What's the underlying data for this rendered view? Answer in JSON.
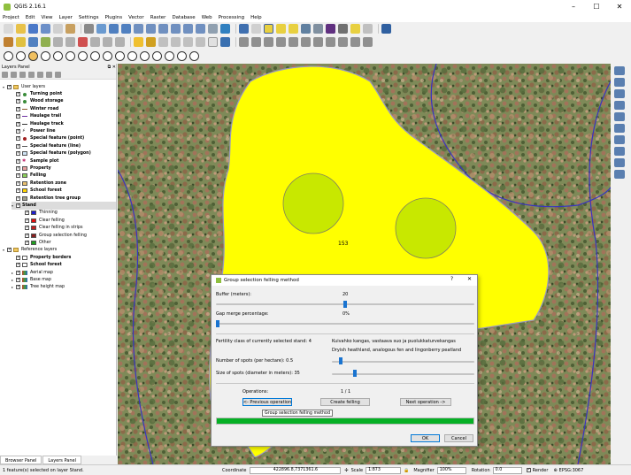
{
  "window": {
    "title": "QGIS 2.16.1",
    "min": "–",
    "max": "☐",
    "close": "✕"
  },
  "menu": [
    "Project",
    "Edit",
    "View",
    "Layer",
    "Settings",
    "Plugins",
    "Vector",
    "Raster",
    "Database",
    "Web",
    "Processing",
    "Help"
  ],
  "layers_panel": {
    "title": "Layers Panel",
    "items": [
      {
        "label": "User layers",
        "bold": false,
        "indent": 0,
        "exp": "▾",
        "sym": "group"
      },
      {
        "label": "Turning point",
        "bold": true,
        "indent": 1,
        "sym": "dot",
        "color": "#3a8c3a"
      },
      {
        "label": "Wood storage",
        "bold": true,
        "indent": 1,
        "sym": "dot",
        "color": "#3a8c3a"
      },
      {
        "label": "Winter road",
        "bold": true,
        "indent": 1,
        "sym": "line",
        "color": "#8a5a2b"
      },
      {
        "label": "Haulage trail",
        "bold": true,
        "indent": 1,
        "sym": "line",
        "color": "#6b2fa0"
      },
      {
        "label": "Haulage track",
        "bold": true,
        "indent": 1,
        "sym": "line",
        "color": "#333333"
      },
      {
        "label": "Power line",
        "bold": true,
        "indent": 1,
        "sym": "power",
        "color": "#000000"
      },
      {
        "label": "Special feature (point)",
        "bold": true,
        "indent": 1,
        "sym": "dot",
        "color": "#a02020"
      },
      {
        "label": "Special feature (line)",
        "bold": true,
        "indent": 1,
        "sym": "line",
        "color": "#555555"
      },
      {
        "label": "Special feature (polygon)",
        "bold": true,
        "indent": 1,
        "sym": "box",
        "color": "#cfe3f3"
      },
      {
        "label": "Sample plot",
        "bold": true,
        "indent": 1,
        "sym": "star",
        "color": "#c03070"
      },
      {
        "label": "Property",
        "bold": true,
        "indent": 1,
        "sym": "box",
        "color": "#e8a0a0"
      },
      {
        "label": "Felling",
        "bold": true,
        "indent": 1,
        "sym": "box",
        "color": "#8bd05a"
      },
      {
        "label": "Retention zone",
        "bold": true,
        "indent": 1,
        "sym": "box",
        "color": "#e8c070"
      },
      {
        "label": "School forest",
        "bold": true,
        "indent": 1,
        "sym": "box",
        "color": "#ffd400"
      },
      {
        "label": "Retention tree group",
        "bold": true,
        "indent": 1,
        "sym": "box",
        "color": "#a0a090"
      },
      {
        "label": "Stand",
        "bold": true,
        "indent": 1,
        "exp": "▾",
        "sym": "none",
        "sel": true
      },
      {
        "label": "Thinning",
        "bold": false,
        "indent": 2,
        "sym": "box",
        "color": "#1f1fd0"
      },
      {
        "label": "Clear felling",
        "bold": false,
        "indent": 2,
        "sym": "box",
        "color": "#e01010"
      },
      {
        "label": "Clear felling in strips",
        "bold": false,
        "indent": 2,
        "sym": "box",
        "color": "#c02020"
      },
      {
        "label": "Group selection felling",
        "bold": false,
        "indent": 2,
        "sym": "box",
        "color": "#8a2020"
      },
      {
        "label": "Other",
        "bold": false,
        "indent": 2,
        "sym": "box",
        "color": "#20a020"
      },
      {
        "label": "Reference layers",
        "bold": false,
        "indent": 0,
        "exp": "▾",
        "sym": "group"
      },
      {
        "label": "Property borders",
        "bold": true,
        "indent": 1,
        "sym": "box",
        "color": "#ffffff"
      },
      {
        "label": "School forest",
        "bold": true,
        "indent": 1,
        "sym": "box",
        "color": "#ffffff"
      },
      {
        "label": "Aerial map",
        "bold": false,
        "indent": 1,
        "exp": "▸",
        "sym": "raster"
      },
      {
        "label": "Base map",
        "bold": false,
        "indent": 1,
        "exp": "▸",
        "sym": "raster"
      },
      {
        "label": "Tree height map",
        "bold": false,
        "indent": 1,
        "exp": "▸",
        "sym": "raster"
      }
    ]
  },
  "bottom_tabs": [
    "Browser Panel",
    "Layers Panel"
  ],
  "map": {
    "stand_label": "153",
    "polygon_color": "#ffff00",
    "circle_color": "#c8e800"
  },
  "dialog": {
    "title": "Group selection felling method",
    "help": "?",
    "close": "✕",
    "buffer_label": "Buffer (meters):",
    "buffer_value": "20",
    "buffer_fraction": 0.5,
    "gap_label": "Gap merge percentage:",
    "gap_value": "0%",
    "gap_fraction": 0.0,
    "fertility_label": "Fertility class of currently selected stand: 4",
    "fertility_fi": "Kuivahko kangas, vastaava suo ja puolukkaturvekangas",
    "fertility_en": "Dryish heathland, analogous fen and lingonberry peatland",
    "spots_label": "Number of spots (per hectare): 0.5",
    "spots_fraction": 0.05,
    "size_label": "Size of spots (diameter in meters): 35",
    "size_fraction": 0.15,
    "operations_label": "Operations:",
    "operations_value": "1 / 1",
    "prev_label": "<- Previous operation",
    "create_label": "Create felling",
    "next_label": "Next operation ->",
    "progress": 1.0,
    "ok_label": "OK",
    "cancel_label": "Cancel"
  },
  "tooltip": "Group selection felling method",
  "status": {
    "message": "1 feature(s) selected on layer Stand.",
    "coordinate_label": "Coordinate",
    "coordinate_value": "422896.8,7371361.6",
    "scale_label": "Scale",
    "scale_value": "1:873",
    "magnifier_label": "Magnifier",
    "magnifier_value": "100%",
    "rotation_label": "Rotation",
    "rotation_value": "0.0",
    "render_label": "Render",
    "crs": "EPSG:3067"
  }
}
